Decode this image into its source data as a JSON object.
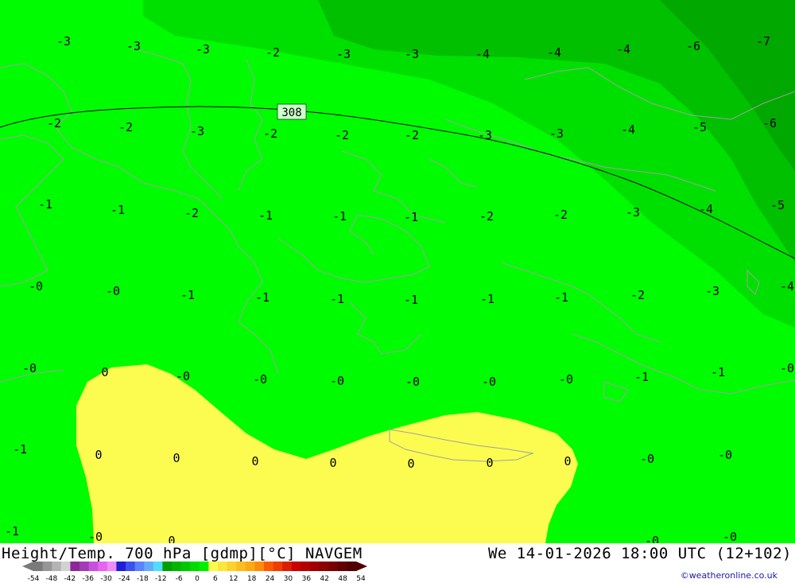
{
  "header": {
    "title_left": "Height/Temp. 700 hPa [gdmp][°C] NAVGEM",
    "title_right": "We 14-01-2026 18:00 UTC (12+102)",
    "credit": "©weatheronline.co.uk"
  },
  "map": {
    "height_contour_label": "308",
    "temperature_labels": [
      {
        "text": "-3"
      },
      {
        "text": "-3"
      },
      {
        "text": "-3"
      },
      {
        "text": "-2"
      },
      {
        "text": "-3"
      },
      {
        "text": "-3"
      },
      {
        "text": "-4"
      },
      {
        "text": "-4"
      },
      {
        "text": "-4"
      },
      {
        "text": "-6"
      },
      {
        "text": "-7"
      },
      {
        "text": "-2"
      },
      {
        "text": "-2"
      },
      {
        "text": "-3"
      },
      {
        "text": "-2"
      },
      {
        "text": "-2"
      },
      {
        "text": "-2"
      },
      {
        "text": "-3"
      },
      {
        "text": "-3"
      },
      {
        "text": "-4"
      },
      {
        "text": "-5"
      },
      {
        "text": "-6"
      },
      {
        "text": "-1"
      },
      {
        "text": "-1"
      },
      {
        "text": "-2"
      },
      {
        "text": "-1"
      },
      {
        "text": "-1"
      },
      {
        "text": "-1"
      },
      {
        "text": "-2"
      },
      {
        "text": "-2"
      },
      {
        "text": "-3"
      },
      {
        "text": "-4"
      },
      {
        "text": "-5"
      },
      {
        "text": "-0"
      },
      {
        "text": "-0"
      },
      {
        "text": "-1"
      },
      {
        "text": "-1"
      },
      {
        "text": "-1"
      },
      {
        "text": "-1"
      },
      {
        "text": "-1"
      },
      {
        "text": "-1"
      },
      {
        "text": "-2"
      },
      {
        "text": "-3"
      },
      {
        "text": "-4"
      },
      {
        "text": "-0"
      },
      {
        "text": "0"
      },
      {
        "text": "-0"
      },
      {
        "text": "-0"
      },
      {
        "text": "-0"
      },
      {
        "text": "-0"
      },
      {
        "text": "-0"
      },
      {
        "text": "-0"
      },
      {
        "text": "-1"
      },
      {
        "text": "-1"
      },
      {
        "text": "-0"
      },
      {
        "text": "-1"
      },
      {
        "text": "0"
      },
      {
        "text": "0"
      },
      {
        "text": "0"
      },
      {
        "text": "0"
      },
      {
        "text": "0"
      },
      {
        "text": "0"
      },
      {
        "text": "0"
      },
      {
        "text": "-0"
      },
      {
        "text": "-0"
      },
      {
        "text": "-1"
      },
      {
        "text": "-0"
      },
      {
        "text": "0"
      },
      {
        "text": "-0"
      },
      {
        "text": "-0"
      }
    ],
    "colors": {
      "band_minus6": "#00a800",
      "band_minus4": "#00c000",
      "band_minus2": "#00e000",
      "band_0_to_minus2": "#00fc00",
      "band_0_to_6": "#fcfc50",
      "coastline": "#a0a0a0",
      "height_contour": "#000000"
    }
  },
  "legend": {
    "tick_labels": [
      "-54",
      "-48",
      "-42",
      "-36",
      "-30",
      "-24",
      "-18",
      "-12",
      "-6",
      "0",
      "6",
      "12",
      "18",
      "24",
      "30",
      "36",
      "42",
      "48",
      "54"
    ],
    "colors": [
      "#7a7a7a",
      "#969696",
      "#b4b4b4",
      "#d2d2d2",
      "#8c2896",
      "#a03cb4",
      "#c850dc",
      "#e664f0",
      "#f08cfa",
      "#1e1ed2",
      "#3c50f0",
      "#5a82fa",
      "#64aaff",
      "#50dcff",
      "#00a000",
      "#00b400",
      "#00c800",
      "#00dc00",
      "#00f000",
      "#fcfc50",
      "#fce63c",
      "#fcd22d",
      "#fcbe1e",
      "#fcaa14",
      "#fc8c0a",
      "#fc5a00",
      "#f03c00",
      "#dc1e00",
      "#c80000",
      "#b40000",
      "#a00000",
      "#8c0000",
      "#780000",
      "#640000",
      "#500000"
    ]
  }
}
